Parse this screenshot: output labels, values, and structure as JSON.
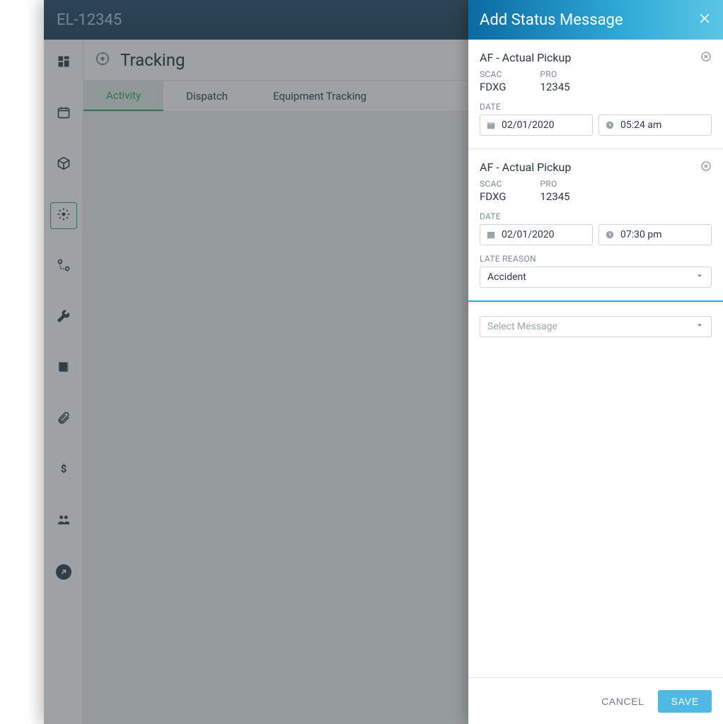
{
  "window": {
    "title": "EL-12345"
  },
  "page": {
    "title": "Tracking"
  },
  "tabs": [
    {
      "label": "Activity",
      "active": true
    },
    {
      "label": "Dispatch",
      "active": false
    },
    {
      "label": "Equipment Tracking",
      "active": false
    }
  ],
  "sidebar": {
    "items": [
      {
        "name": "dashboard-icon"
      },
      {
        "name": "calendar-icon"
      },
      {
        "name": "package-icon"
      },
      {
        "name": "tracking-icon",
        "active": true
      },
      {
        "name": "route-icon"
      },
      {
        "name": "wrench-icon"
      },
      {
        "name": "book-icon"
      },
      {
        "name": "attachment-icon"
      },
      {
        "name": "dollar-icon"
      },
      {
        "name": "people-icon"
      },
      {
        "name": "launch-icon"
      }
    ]
  },
  "panel": {
    "title": "Add Status Message",
    "blocks": [
      {
        "title": "AF - Actual Pickup",
        "scac_label": "SCAC",
        "scac": "FDXG",
        "pro_label": "PRO",
        "pro": "12345",
        "date_label": "DATE",
        "date": "02/01/2020",
        "time": "05:24 am"
      },
      {
        "title": "AF - Actual Pickup",
        "scac_label": "SCAC",
        "scac": "FDXG",
        "pro_label": "PRO",
        "pro": "12345",
        "date_label": "DATE",
        "date": "02/01/2020",
        "time": "07:30 pm",
        "late_reason_label": "LATE REASON",
        "late_reason": "Accident"
      }
    ],
    "select_placeholder": "Select Message",
    "cancel_label": "CANCEL",
    "save_label": "SAVE"
  }
}
